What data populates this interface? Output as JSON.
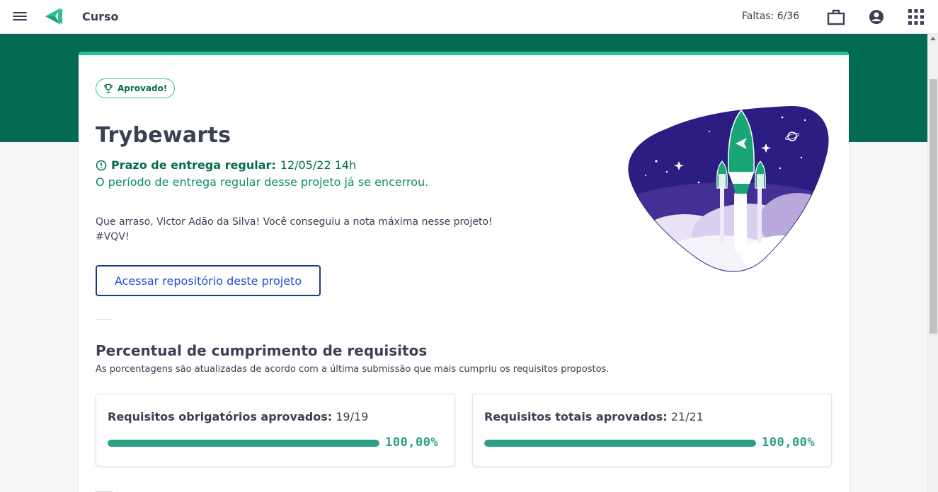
{
  "header": {
    "course_label": "Curso",
    "absences": "Faltas: 6/36",
    "icons": [
      "menu-icon",
      "trybe-logo-icon",
      "briefcase-icon",
      "account-circle-icon",
      "apps-grid-icon"
    ]
  },
  "project": {
    "status_badge": "Aprovado!",
    "title": "Trybewarts",
    "deadline_label": "Prazo de entrega regular:",
    "deadline_value": "12/05/22 14h",
    "closed_message": "O período de entrega regular desse projeto já se encerrou.",
    "grade_message_line1": "Que arraso, Victor Adão da Silva! Você conseguiu a nota máxima nesse projeto!",
    "grade_message_line2": "#VQV!",
    "repo_button_label": "Acessar repositório deste projeto"
  },
  "requirements": {
    "section_title": "Percentual de cumprimento de requisitos",
    "section_subtitle": "As porcentagens são atualizadas de acordo com a última submissão que mais cumpriu os requisitos propostos.",
    "cards": [
      {
        "label": "Requisitos obrigatórios aprovados:",
        "value": "19/19",
        "percent_text": "100,00%",
        "fraction": 1.0
      },
      {
        "label": "Requisitos totais aprovados:",
        "value": "21/21",
        "percent_text": "100,00%",
        "fraction": 1.0
      }
    ]
  },
  "colors": {
    "brand_dark_green": "#036b52",
    "brand_green": "#2fc18c",
    "progress_green": "#2d9f86",
    "link_blue": "#1d4ed8",
    "text": "#3b4152",
    "illustration_purple": "#2b1d82"
  }
}
